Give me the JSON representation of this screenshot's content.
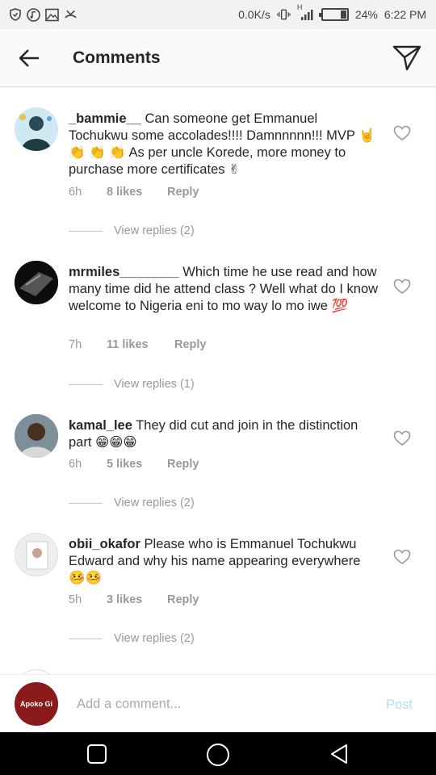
{
  "status_bar": {
    "net_speed": "0.0K/s",
    "signal_label": "H",
    "battery_percent": "24%",
    "battery_level": 0.24,
    "time": "6:22 PM"
  },
  "header": {
    "title": "Comments"
  },
  "comments": [
    {
      "username": "_bammie__",
      "text": " Can someone get Emmanuel Tochukwu some accolades!!!! Damnnnnn!!! MVP 🤘 👏 👏 👏 As per uncle Korede, more money to purchase more certificates ✌",
      "time": "6h",
      "likes": "8 likes",
      "reply": "Reply",
      "view_replies": "View replies (2)"
    },
    {
      "username": "mrmiles________",
      "text": " Which time he use read and how many time did he attend class ? Well what do I know welcome to Nigeria eni to mo way lo mo iwe 💯",
      "time": "7h",
      "likes": "11 likes",
      "reply": "Reply",
      "view_replies": "View replies (1)"
    },
    {
      "username": "kamal_lee",
      "text": " They did cut and join in the distinction part 😁😁😁",
      "time": "6h",
      "likes": "5 likes",
      "reply": "Reply",
      "view_replies": "View replies (2)"
    },
    {
      "username": "obii_okafor",
      "text": " Please who is Emmanuel Tochukwu Edward  and why his name appearing everywhere 🤒🤒",
      "time": "5h",
      "likes": "3 likes",
      "reply": "Reply",
      "view_replies": "View replies (2)"
    }
  ],
  "composer": {
    "placeholder": "Add a comment...",
    "post_label": "Post",
    "avatar_text": "Apoko Gi"
  },
  "colors": {
    "text": "#262626",
    "meta": "#999999",
    "post_disabled": "#b3dbff",
    "nav_bg": "#000000"
  }
}
